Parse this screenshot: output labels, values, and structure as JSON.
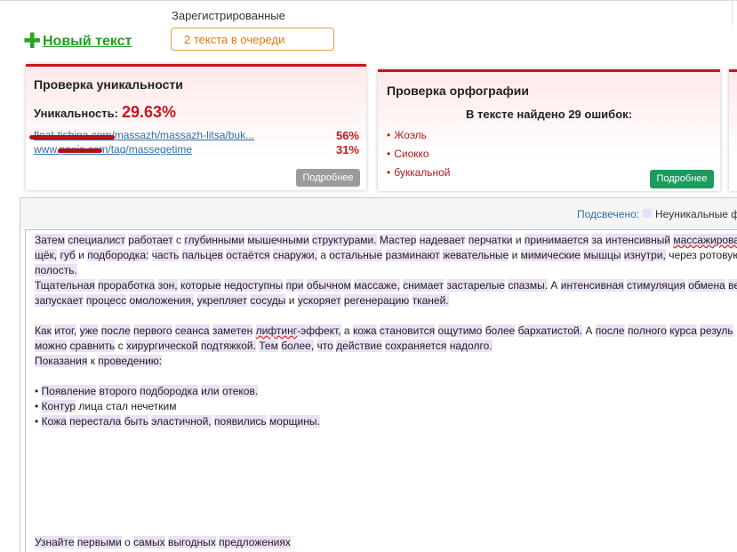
{
  "header": {
    "new_text_label": "Новый текст",
    "registered_label": "Зарегистрированные",
    "queue_value": "2 текста в очереди"
  },
  "uniqueness": {
    "title": "Проверка уникальности",
    "label": "Уникальность:",
    "value": "29.63%",
    "sources": [
      {
        "url": "float-tishina.com/massazh/massazh-litsa/buk...",
        "percent": "56%"
      },
      {
        "url": "www.paeis.com/tag/massegetime",
        "percent": "31%"
      }
    ],
    "more_button": "Подробнее"
  },
  "spelling": {
    "title": "Проверка орфографии",
    "summary": "В тексте найдено 29 ошибок:",
    "errors": [
      "Жоэль",
      "Сиокко",
      "буккальной"
    ],
    "more_button": "Подробнее"
  },
  "highlight": {
    "label": "Подсвечено:",
    "legend": "Неуникальные ф"
  },
  "colors": {
    "accent_red": "#c8161e",
    "green_button": "#1d9b5e",
    "highlight_purple": "#ebe1f6",
    "link_blue": "#2f6fa8"
  },
  "text_lines": [
    "Затем специалист работает с глубинными мышечными структурами. Мастер надевает перчатки и принимается за интенсивный массажирован",
    "щёк, губ и подбородка: часть пальцев остаётся снаружи, а остальные разминают жевательные и мимические мышцы изнутри, через ротовую",
    "полость.",
    "Тщательная проработка зон, которые недоступны при обычном массаже, снимает застарелые спазмы. А интенсивная стимуляция обмена ве",
    "запускает процесс омоложения, укрепляет сосуды и ускоряет регенерацию тканей.",
    "",
    "Как итог, уже после первого сеанса заметен лифтинг-эффект, а кожа становится ощутимо более бархатистой. А после полного курса резуль",
    "можно сравнить с хирургической подтяжкой. Тем более, что действие сохраняется надолго.",
    "Показания к проведению:",
    "",
    "• Появление второго подбородка или отеков.",
    "• Контур лица стал нечетким",
    "• Кожа перестала быть эластичной, появились морщины.",
    "",
    "",
    "",
    "",
    "",
    "",
    "",
    "Узнайте первыми о самых выгодных предложениях"
  ]
}
